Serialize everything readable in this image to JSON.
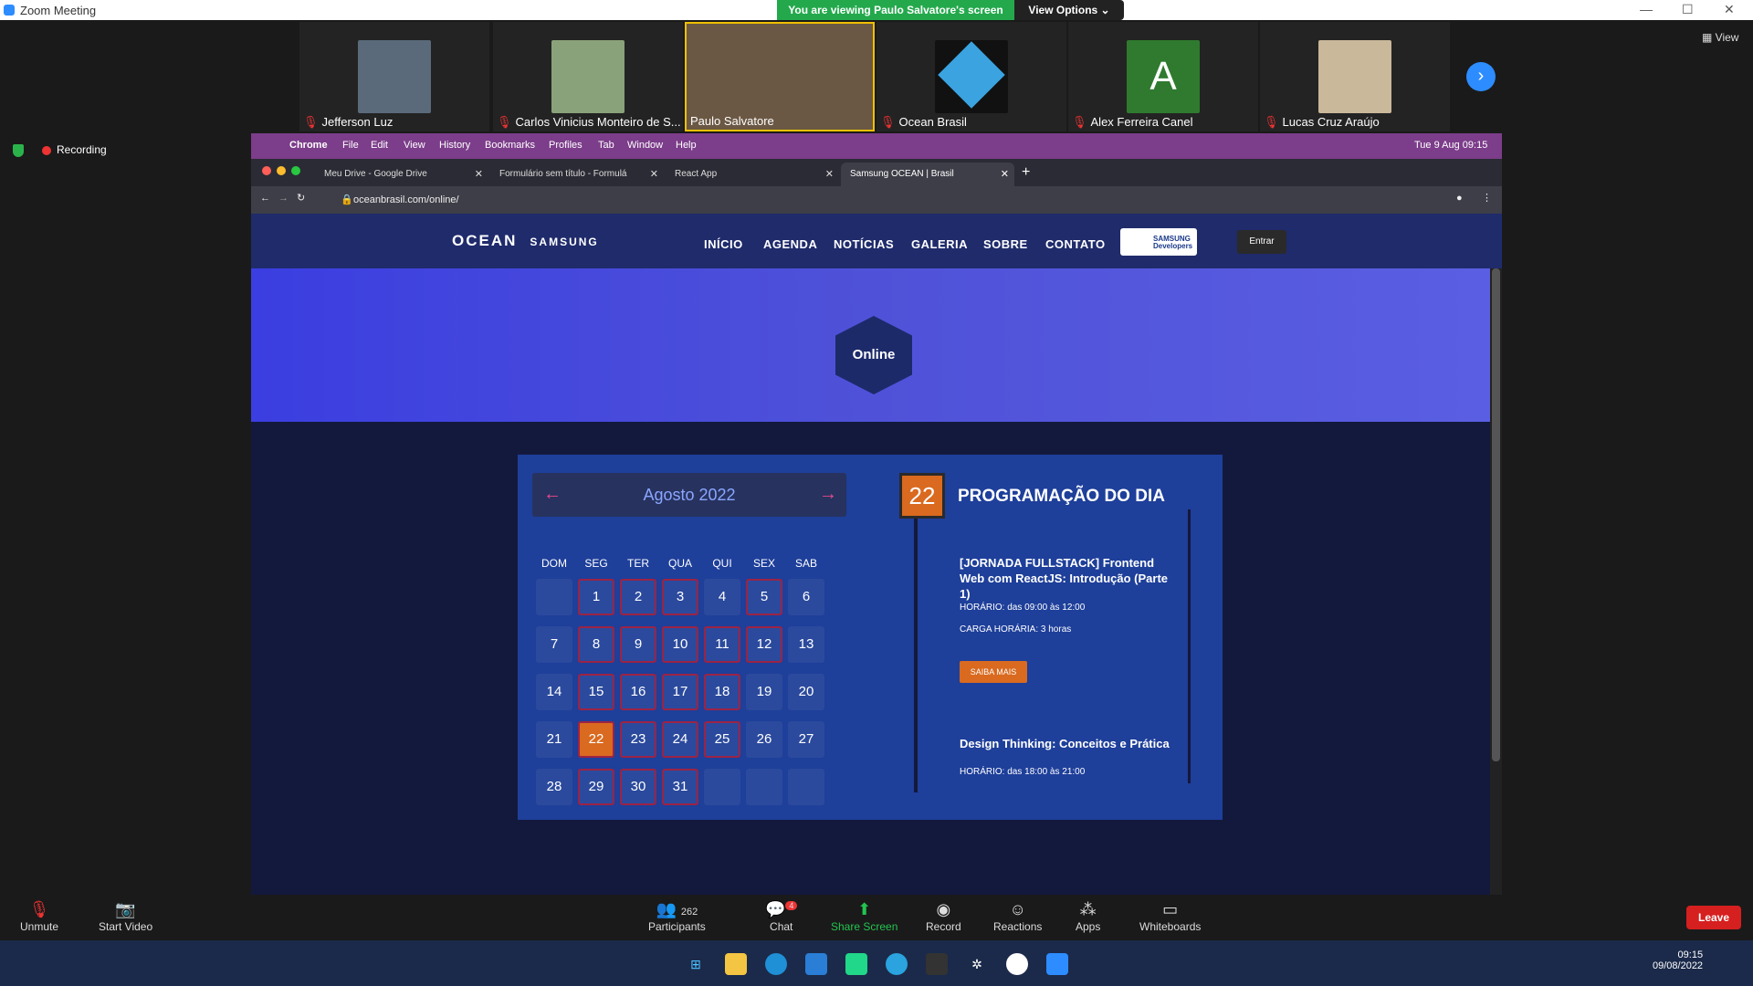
{
  "window": {
    "title": "Zoom Meeting"
  },
  "banner": {
    "viewing": "You are viewing Paulo Salvatore's screen",
    "view_options": "View Options ⌄"
  },
  "participants": [
    {
      "name": "Jefferson Luz"
    },
    {
      "name": "Carlos Vinicius Monteiro de S..."
    },
    {
      "name": "Paulo Salvatore"
    },
    {
      "name": "Ocean Brasil"
    },
    {
      "name": "Alex Ferreira Canel",
      "initial": "A"
    },
    {
      "name": "Lucas Cruz Araújo"
    }
  ],
  "view_label": "View",
  "recording": "Recording",
  "mac": {
    "app": "Chrome",
    "menus": [
      "File",
      "Edit",
      "View",
      "History",
      "Bookmarks",
      "Profiles",
      "Tab",
      "Window",
      "Help"
    ],
    "clock": "Tue 9 Aug  09:15"
  },
  "tabs": [
    {
      "label": "Meu Drive - Google Drive"
    },
    {
      "label": "Formulário sem título - Formulá"
    },
    {
      "label": "React App"
    },
    {
      "label": "Samsung OCEAN | Brasil"
    }
  ],
  "url": "oceanbrasil.com/online/",
  "site": {
    "logo": "OCEAN",
    "logo_brand": "SAMSUNG",
    "nav": [
      "INÍCIO",
      "AGENDA",
      "NOTÍCIAS",
      "GALERIA",
      "SOBRE",
      "CONTATO"
    ],
    "dev_badge": "SAMSUNG Developers",
    "entrar": "Entrar",
    "hero_label": "Online"
  },
  "calendar": {
    "month": "Agosto 2022",
    "dow": [
      "DOM",
      "SEG",
      "TER",
      "QUA",
      "QUI",
      "SEX",
      "SAB"
    ],
    "selected": 22,
    "event_days": [
      1,
      2,
      3,
      5,
      8,
      9,
      10,
      11,
      12,
      15,
      16,
      17,
      18,
      22,
      23,
      24,
      25,
      29,
      30,
      31
    ]
  },
  "program": {
    "day": "22",
    "title": "PROGRAMAÇÃO DO DIA",
    "events": [
      {
        "title": "[JORNADA FULLSTACK] Frontend Web com ReactJS: Introdução (Parte 1)",
        "horario": "HORÁRIO: das 09:00 às 12:00",
        "carga": "CARGA HORÁRIA: 3 horas",
        "button": "SAIBA MAIS"
      },
      {
        "title": "Design Thinking: Conceitos e Prática",
        "horario": "HORÁRIO: das 18:00 às 21:00"
      }
    ]
  },
  "toolbar": {
    "unmute": "Unmute",
    "start_video": "Start Video",
    "participants": "Participants",
    "participants_count": "262",
    "chat": "Chat",
    "chat_badge": "4",
    "share": "Share Screen",
    "record": "Record",
    "reactions": "Reactions",
    "apps": "Apps",
    "whiteboards": "Whiteboards",
    "leave": "Leave"
  },
  "taskbar": {
    "time": "09:15",
    "date": "09/08/2022"
  }
}
